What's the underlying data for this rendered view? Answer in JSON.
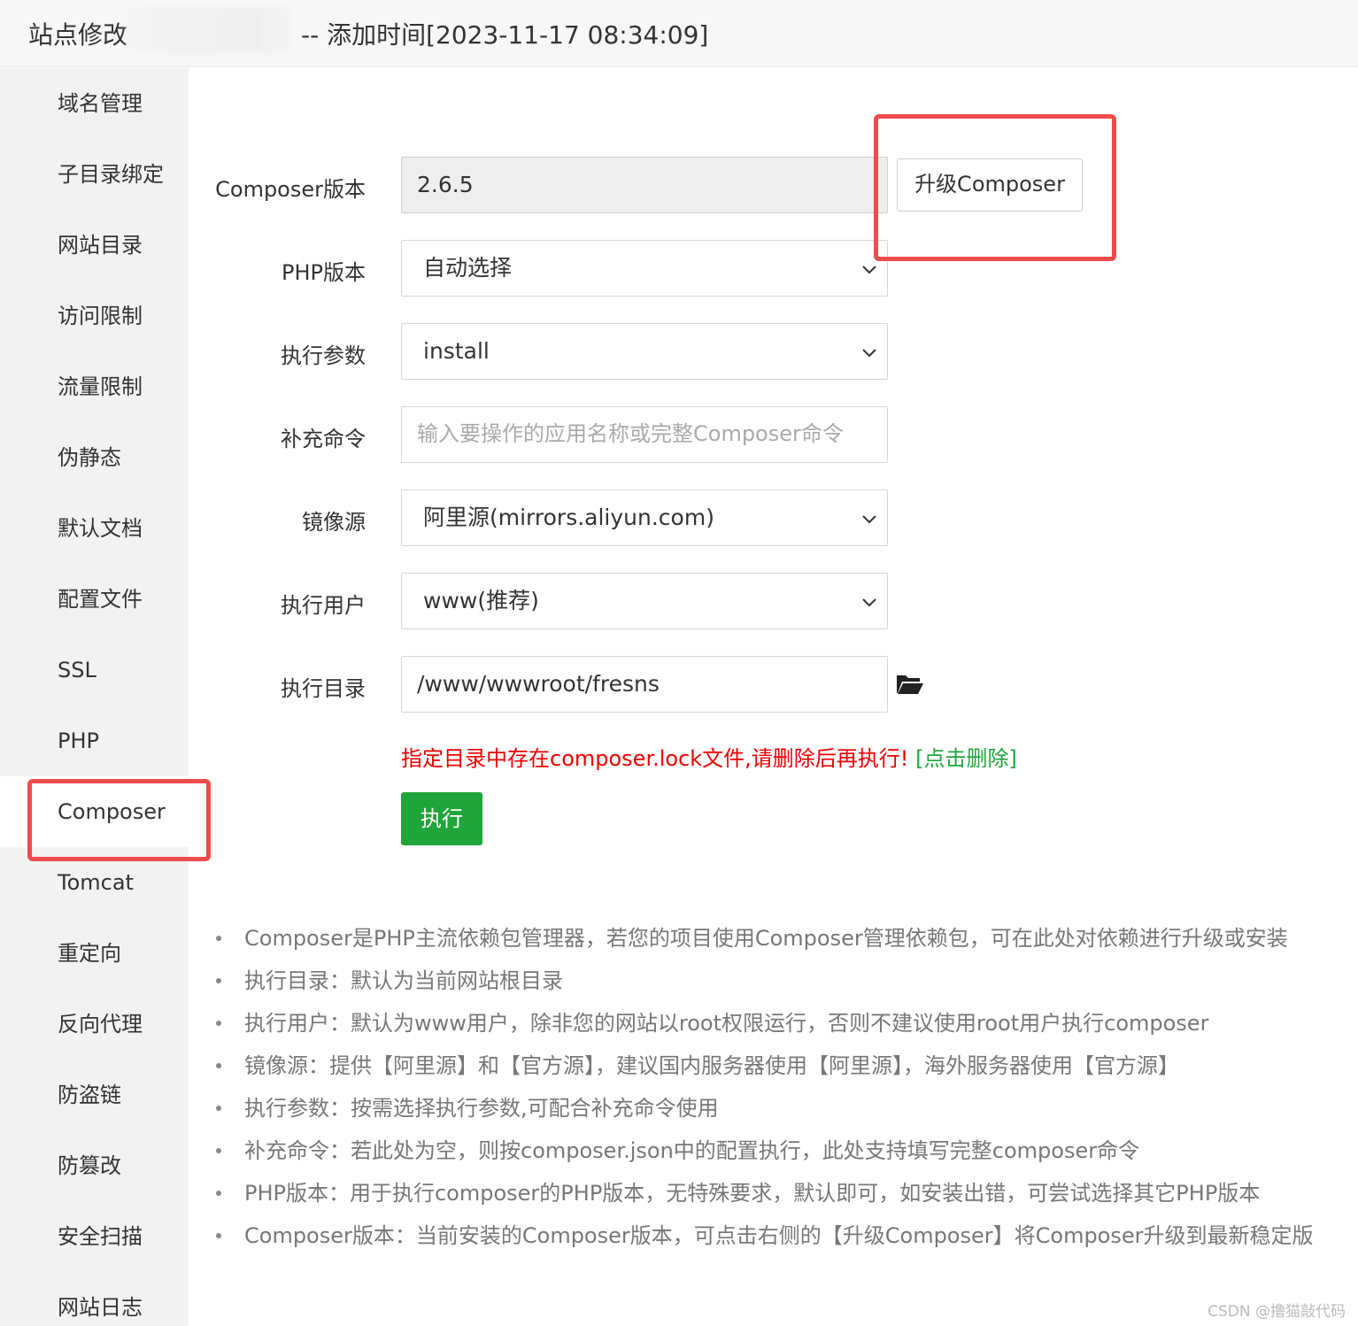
{
  "titlebar": {
    "prefix": "站点修改",
    "suffix": "-- 添加时间[2023-11-17 08:34:09]"
  },
  "sidebar": {
    "items": [
      {
        "label": "域名管理"
      },
      {
        "label": "子目录绑定"
      },
      {
        "label": "网站目录"
      },
      {
        "label": "访问限制"
      },
      {
        "label": "流量限制"
      },
      {
        "label": "伪静态"
      },
      {
        "label": "默认文档"
      },
      {
        "label": "配置文件"
      },
      {
        "label": "SSL"
      },
      {
        "label": "PHP"
      },
      {
        "label": "Composer",
        "active": true
      },
      {
        "label": "Tomcat"
      },
      {
        "label": "重定向"
      },
      {
        "label": "反向代理"
      },
      {
        "label": "防盗链"
      },
      {
        "label": "防篡改"
      },
      {
        "label": "安全扫描"
      },
      {
        "label": "网站日志"
      }
    ]
  },
  "form": {
    "composer_version": {
      "label": "Composer版本",
      "value": "2.6.5"
    },
    "upgrade_button": "升级Composer",
    "php_version": {
      "label": "PHP版本",
      "value": "自动选择"
    },
    "exec_args": {
      "label": "执行参数",
      "value": "install"
    },
    "extra_cmd": {
      "label": "补充命令",
      "placeholder": "输入要操作的应用名称或完整Composer命令"
    },
    "mirror": {
      "label": "镜像源",
      "value": "阿里源(mirrors.aliyun.com)"
    },
    "exec_user": {
      "label": "执行用户",
      "value": "www(推荐)"
    },
    "exec_dir": {
      "label": "执行目录",
      "value": "/www/wwwroot/fresns"
    },
    "warning": "指定目录中存在composer.lock文件,请删除后再执行!",
    "delete_link": "[点击删除]",
    "exec_button": "执行"
  },
  "tips": [
    "Composer是PHP主流依赖包管理器，若您的项目使用Composer管理依赖包，可在此处对依赖进行升级或安装",
    "执行目录：默认为当前网站根目录",
    "执行用户：默认为www用户，除非您的网站以root权限运行，否则不建议使用root用户执行composer",
    "镜像源：提供【阿里源】和【官方源】，建议国内服务器使用【阿里源】，海外服务器使用【官方源】",
    "执行参数：按需选择执行参数,可配合补充命令使用",
    "补充命令：若此处为空，则按composer.json中的配置执行，此处支持填写完整composer命令",
    "PHP版本：用于执行composer的PHP版本，无特殊要求，默认即可，如安装出错，可尝试选择其它PHP版本",
    "Composer版本：当前安装的Composer版本，可点击右侧的【升级Composer】将Composer升级到最新稳定版"
  ],
  "watermark": "CSDN @撸猫敲代码",
  "colors": {
    "accent_green": "#20a53a",
    "warning_red": "#ee0000",
    "highlight_box": "#ee4b4b"
  },
  "icons": {
    "select_arrow": "chevron-down-icon",
    "directory_picker": "folder-open-icon"
  }
}
